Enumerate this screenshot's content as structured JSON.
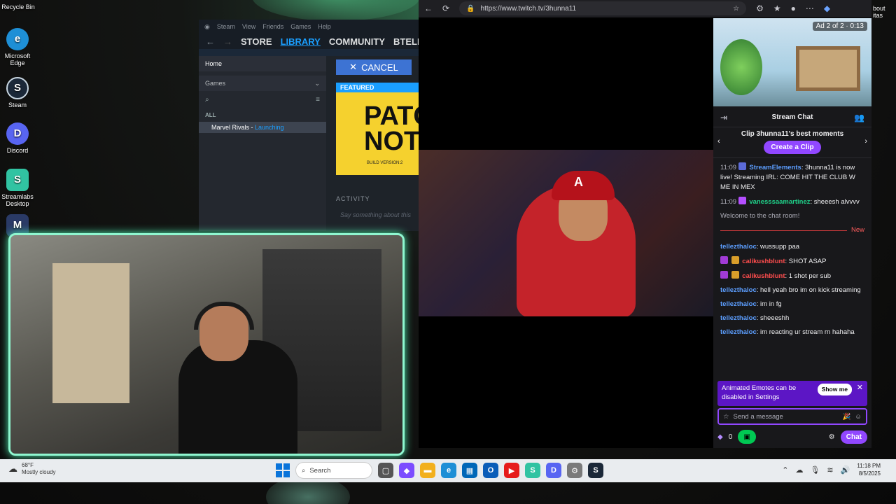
{
  "desktop": {
    "icons": [
      {
        "label": "Recycle Bin",
        "glyph": "🗑",
        "color": "#6b7b8c"
      },
      {
        "label": "Microsoft Edge",
        "glyph": "e",
        "color": "#1e8fd6"
      },
      {
        "label": "Steam",
        "glyph": "S",
        "color": "#1b2838"
      },
      {
        "label": "Discord",
        "glyph": "D",
        "color": "#5865f2"
      },
      {
        "label": "Streamlabs Desktop",
        "glyph": "S",
        "color": "#31c3a2"
      }
    ],
    "right_stub": "bout\nitas"
  },
  "steam": {
    "menu": [
      "Steam",
      "View",
      "Friends",
      "Games",
      "Help"
    ],
    "nav": [
      "STORE",
      "LIBRARY",
      "COMMUNITY",
      "BTELLEZSI"
    ],
    "home": "Home",
    "games_label": "Games",
    "all_label": "ALL",
    "game_name": "Marvel Rivals",
    "game_status": "Launching",
    "cancel_label": "CANCEL",
    "featured_label": "FEATURED",
    "featured_text": "PATC NOT",
    "featured_sub": "BUILD VERSION:2",
    "activity_label": "ACTIVITY",
    "activity_placeholder": "Say something about this"
  },
  "browser": {
    "url": "https://www.twitch.tv/3hunna11"
  },
  "twitch": {
    "ad_badge": "Ad 2 of 2 · 0:13",
    "chat_title": "Stream Chat",
    "clip_title": "Clip 3hunna11's best moments",
    "clip_button": "Create a Clip",
    "messages": [
      {
        "time": "11:09",
        "user": "StreamElements",
        "text": ": 3hunna11 is now live! Streaming IRL: COME HIT THE CLUB W ME IN MEX",
        "ucolor": "blue"
      },
      {
        "time": "11:09",
        "user": "vanesssaamartinez",
        "text": ": sheeesh alvvvv",
        "ucolor": "green"
      },
      {
        "time": "",
        "user": "",
        "text": "Welcome to the chat room!",
        "ucolor": ""
      }
    ],
    "new_label": "New",
    "messages_new": [
      {
        "user": "tellezthaloc",
        "text": ": wussupp paa",
        "ucolor": "blue"
      },
      {
        "user": "calikushblunt",
        "text": ": SHOT ASAP",
        "ucolor": "red"
      },
      {
        "user": "calikushblunt",
        "text": ": 1 shot per sub",
        "ucolor": "red"
      },
      {
        "user": "tellezthaloc",
        "text": ": hell yeah bro im on kick streaming",
        "ucolor": "blue"
      },
      {
        "user": "tellezthaloc",
        "text": ": im in fg",
        "ucolor": "blue"
      },
      {
        "user": "tellezthaloc",
        "text": ": sheeeshh",
        "ucolor": "blue"
      },
      {
        "user": "tellezthaloc",
        "text": ": im reacting ur stream rn hahaha",
        "ucolor": "blue"
      }
    ],
    "notice_text": "Animated Emotes can be disabled in Settings",
    "notice_button": "Show me",
    "input_placeholder": "Send a message",
    "points": "0",
    "chat_button": "Chat"
  },
  "taskbar": {
    "temperature": "68°F",
    "weather": "Mostly cloudy",
    "search_label": "Search",
    "time": "11:18 PM",
    "date": "8/5/2025"
  }
}
